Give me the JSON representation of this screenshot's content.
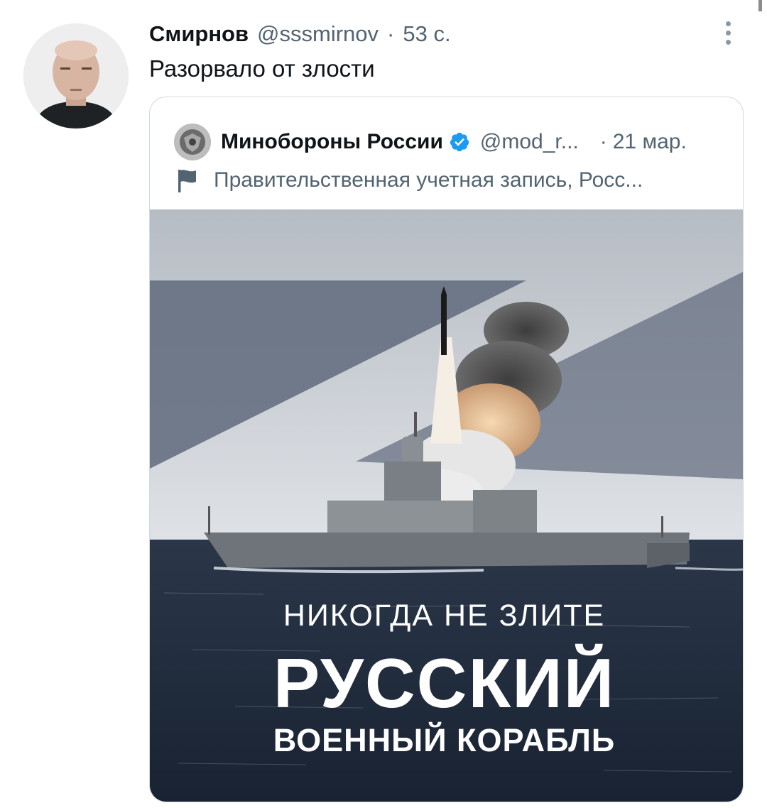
{
  "tweet": {
    "author_name": "Смирнов",
    "author_handle": "@sssmirnov",
    "separator": "·",
    "time": "53 с.",
    "text": "Разорвало от злости",
    "avatar_icon": "user-photo",
    "more_icon": "more-vertical-icon"
  },
  "quoted_tweet": {
    "author_name": "Минобороны России",
    "verified_icon": "verified-badge-icon",
    "verified_color": "#1d9bf0",
    "author_handle": "@mod_r...",
    "separator": "·",
    "time": "21 мар.",
    "gov_label": "Правительственная учетная запись, Росс...",
    "flag_icon": "flag-icon",
    "image": {
      "line1": "НИКОГДА НЕ ЗЛИТЕ",
      "line2": "РУССКИЙ",
      "line3": "ВОЕННЫЙ КОРАБЛЬ"
    }
  },
  "colors": {
    "text_primary": "#0f1419",
    "text_secondary": "#536471",
    "card_border": "#cfd9de",
    "sky": "#c8ccd2",
    "sea": "#1f2a3a"
  }
}
